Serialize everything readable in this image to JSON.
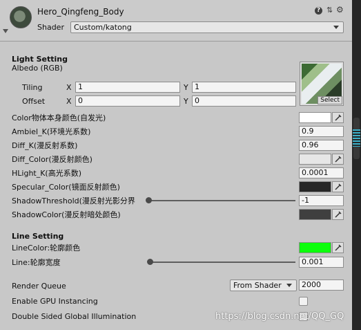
{
  "header": {
    "material_name": "Hero_Qingfeng_Body",
    "shader_label": "Shader",
    "shader_value": "Custom/katong",
    "icons": [
      "help-icon",
      "preset-icon",
      "gear-icon"
    ]
  },
  "light_setting": {
    "heading": "Light Setting",
    "albedo_label": "Albedo (RGB)",
    "select_label": "Select",
    "tiling_label": "Tiling",
    "offset_label": "Offset",
    "x_label": "X",
    "y_label": "Y",
    "tiling_x": "1",
    "tiling_y": "1",
    "offset_x": "0",
    "offset_y": "0",
    "color_label": "Color物体本身颜色(自发光)",
    "ambient_label": "Ambiel_K(环境光系数)",
    "ambient_value": "0.9",
    "diff_k_label": "Diff_K(漫反射系数)",
    "diff_k_value": "0.96",
    "diff_color_label": "Diff_Color(漫反射颜色)",
    "hlight_label": "HLight_K(高光系数)",
    "hlight_value": "0.0001",
    "specular_label": "Specular_Color(镜面反射颜色)",
    "shadow_threshold_label": "ShadowThreshold(漫反射光影分界",
    "shadow_threshold_value": "-1",
    "shadow_color_label": "ShadowColor(漫反射暗处颜色)"
  },
  "line_setting": {
    "heading": "Line Setting",
    "line_color_label": "LineColor:轮廓颜色",
    "line_width_label": "Line:轮廓宽度",
    "line_width_value": "0.001"
  },
  "render": {
    "queue_label": "Render Queue",
    "queue_dropdown": "From Shader",
    "queue_value": "2000",
    "gpu_label": "Enable GPU Instancing",
    "double_sided_label": "Double Sided Global Illumination"
  },
  "watermark": "https://blog.csdn.net/QQ_GQ",
  "colors": {
    "color": "#ffffff",
    "diff_color": "#e6e6e6",
    "specular_color": "#262626",
    "shadow_color": "#3f3f3f",
    "line_color": "#0cff0c"
  },
  "sliders": {
    "shadow_threshold_fraction": 0.0,
    "line_width_fraction": 0.0
  }
}
